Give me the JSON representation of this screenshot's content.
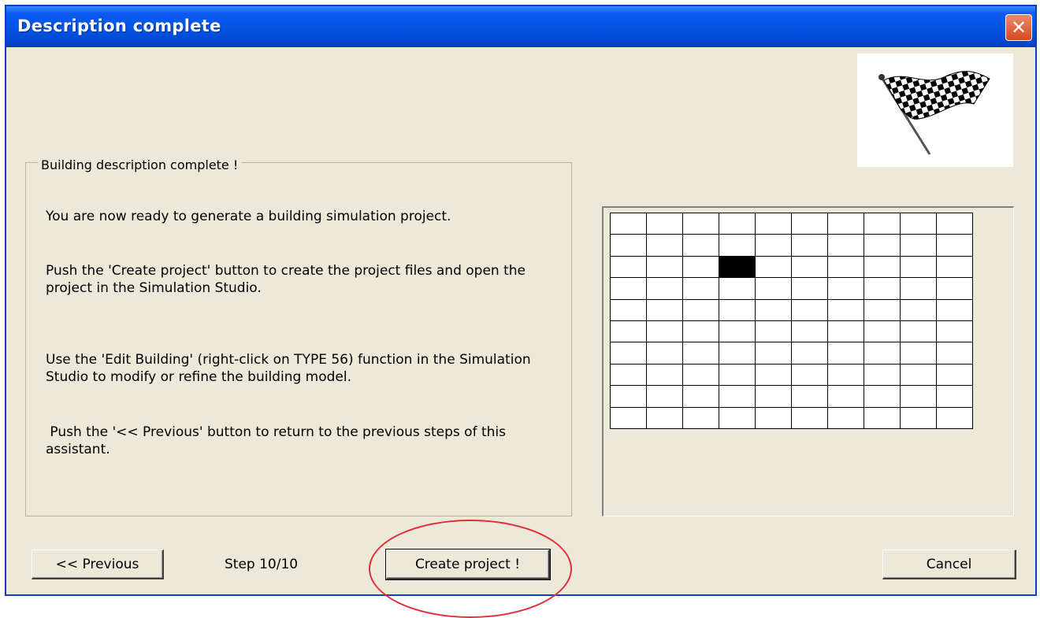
{
  "window": {
    "title": "Description complete",
    "close_icon": "close-icon"
  },
  "group": {
    "legend": "Building description complete !",
    "paragraphs": [
      "You are now ready to generate a building simulation project.",
      "Push the 'Create project' button to create the project files and open the project in the Simulation Studio.",
      "Use the 'Edit Building' (right-click on TYPE 56) function in the Simulation Studio to modify or refine the building model.",
      " Push the '<< Previous' button to return to the previous steps of this assistant."
    ]
  },
  "flag_image": "checkered-flag-icon",
  "grid": {
    "rows": 10,
    "cols": 10,
    "filled_cells": [
      {
        "row": 2,
        "col": 3
      }
    ]
  },
  "footer": {
    "previous_label": "<< Previous",
    "step_text": "Step 10/10",
    "create_label": "Create project !",
    "cancel_label": "Cancel"
  },
  "annotation": {
    "highlight_color": "#e0303a"
  },
  "colors": {
    "title_bar": "#0455e6",
    "window_bg": "#ece9d8",
    "close_button": "#d9481f"
  }
}
